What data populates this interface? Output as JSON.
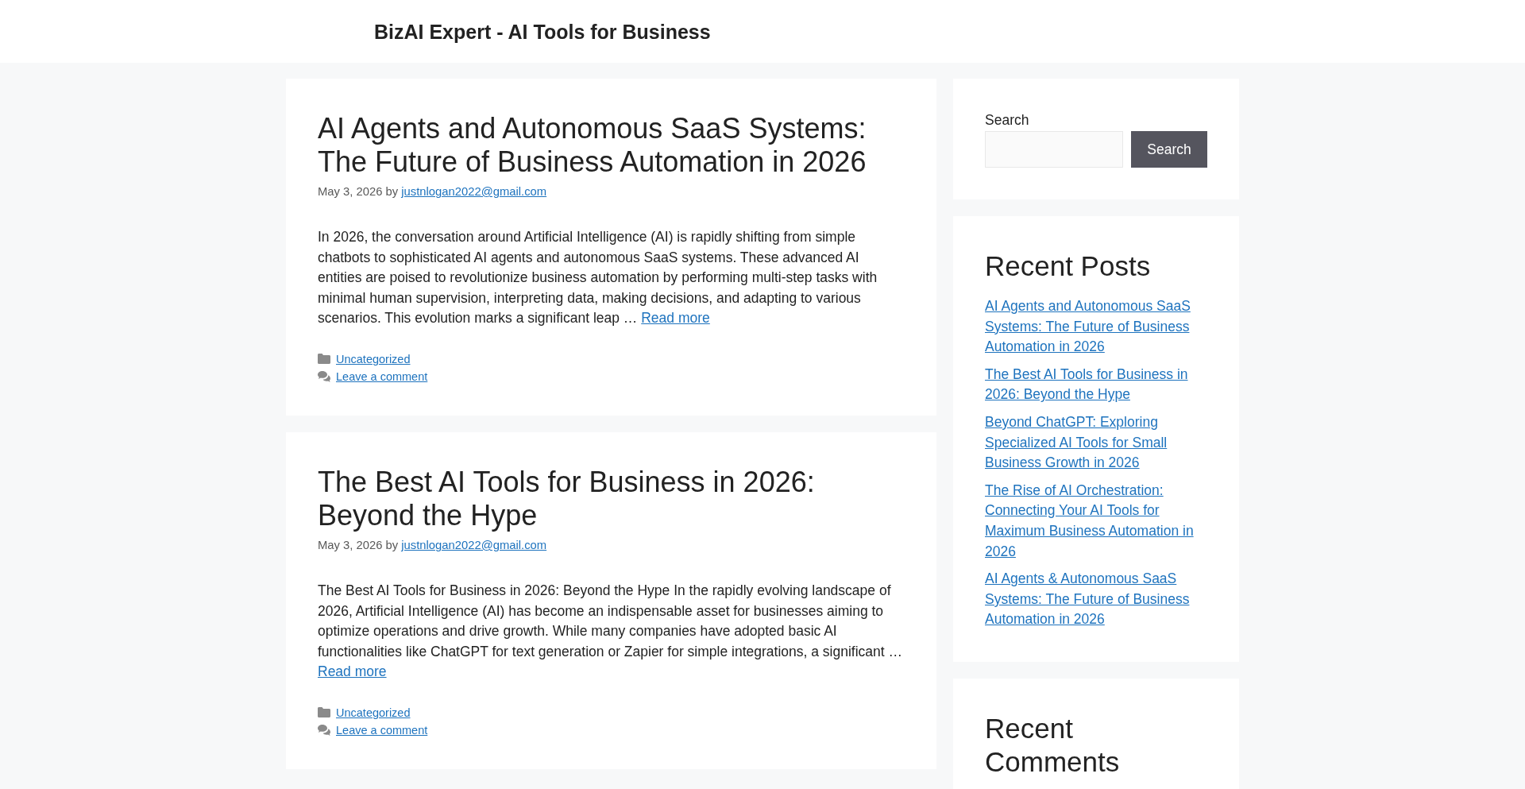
{
  "site_header": {
    "title": "BizAI Expert - AI Tools for Business"
  },
  "posts": [
    {
      "title": "AI Agents and Autonomous SaaS Systems: The Future of Business Automation in 2026",
      "date": "May 3, 2026",
      "author_prefix": "by",
      "author": "justnlogan2022@gmail.com",
      "excerpt": "In 2026, the conversation around Artificial Intelligence (AI) is rapidly shifting from simple chatbots to sophisticated AI agents and autonomous SaaS systems. These advanced AI entities are poised to revolutionize business automation by performing multi-step tasks with minimal human supervision, interpreting data, making decisions, and adapting to various scenarios. This evolution marks a significant leap …",
      "read_more": "Read more",
      "category": "Uncategorized",
      "comment_link": "Leave a comment"
    },
    {
      "title": "The Best AI Tools for Business in 2026: Beyond the Hype",
      "date": "May 3, 2026",
      "author_prefix": "by",
      "author": "justnlogan2022@gmail.com",
      "excerpt": "The Best AI Tools for Business in 2026: Beyond the Hype In the rapidly evolving landscape of 2026, Artificial Intelligence (AI) has become an indispensable asset for businesses aiming to optimize operations and drive growth. While many companies have adopted basic AI functionalities like ChatGPT for text generation or Zapier for simple integrations, a significant …",
      "read_more": "Read more",
      "category": "Uncategorized",
      "comment_link": "Leave a comment"
    }
  ],
  "sidebar": {
    "search": {
      "label": "Search",
      "button": "Search"
    },
    "recent_posts": {
      "title": "Recent Posts",
      "items": [
        "AI Agents and Autonomous SaaS Systems: The Future of Business Automation in 2026",
        "The Best AI Tools for Business in 2026: Beyond the Hype",
        "Beyond ChatGPT: Exploring Specialized AI Tools for Small Business Growth in 2026",
        "The Rise of AI Orchestration: Connecting Your AI Tools for Maximum Business Automation in 2026",
        "AI Agents & Autonomous SaaS Systems: The Future of Business Automation in 2026"
      ]
    },
    "recent_comments": {
      "title": "Recent Comments"
    }
  }
}
